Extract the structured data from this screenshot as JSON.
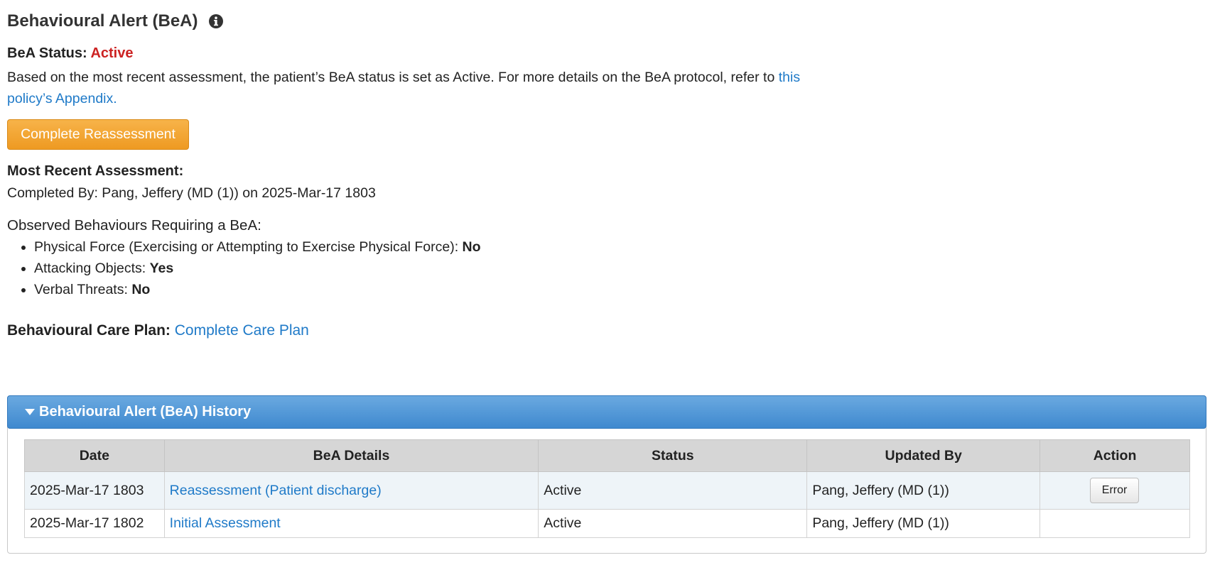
{
  "header": {
    "title": "Behavioural Alert (BeA)",
    "info_icon": "info-circle-icon"
  },
  "status": {
    "label": "BeA Status:",
    "value": "Active",
    "value_color": "#cc2222"
  },
  "description": {
    "text": "Based on the most recent assessment, the patient’s BeA status is set as Active. For more details on the BeA protocol, refer to ",
    "link_text": "this policy’s Appendix."
  },
  "actions": {
    "reassess_label": "Complete Reassessment"
  },
  "recent_assessment": {
    "heading": "Most Recent Assessment:",
    "completed_by": "Completed By: Pang, Jeffery (MD (1)) on 2025-Mar-17 1803"
  },
  "observed": {
    "heading": "Observed Behaviours Requiring a BeA:",
    "items": [
      {
        "label": "Physical Force (Exercising or Attempting to Exercise Physical Force):",
        "value": "No"
      },
      {
        "label": "Attacking Objects:",
        "value": "Yes"
      },
      {
        "label": "Verbal Threats:",
        "value": "No"
      }
    ]
  },
  "care_plan": {
    "label": "Behavioural Care Plan:",
    "link_text": "Complete Care Plan"
  },
  "history": {
    "title": "Behavioural Alert (BeA) History",
    "columns": [
      "Date",
      "BeA Details",
      "Status",
      "Updated By",
      "Action"
    ],
    "rows": [
      {
        "date": "2025-Mar-17 1803",
        "details": "Reassessment (Patient discharge)",
        "status": "Active",
        "updated_by": "Pang, Jeffery (MD (1))",
        "action": "Error"
      },
      {
        "date": "2025-Mar-17 1802",
        "details": "Initial Assessment",
        "status": "Active",
        "updated_by": "Pang, Jeffery (MD (1))",
        "action": ""
      }
    ]
  },
  "colors": {
    "accent_orange": "#ee9a22",
    "link_blue": "#1f7ac8",
    "panel_blue": "#4a90d9"
  }
}
